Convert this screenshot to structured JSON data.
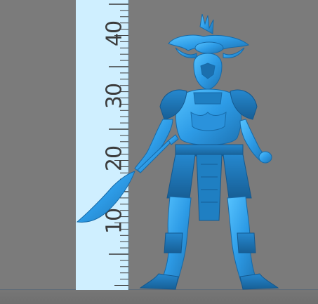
{
  "scene": {
    "background_color": "#7b7b7b",
    "model_color": "#2f9fe8",
    "ruler_color": "#cfefff"
  },
  "ruler": {
    "labels": [
      "40",
      "30",
      "20",
      "10"
    ]
  },
  "model": {
    "icon": "warrior-miniature-figure"
  }
}
